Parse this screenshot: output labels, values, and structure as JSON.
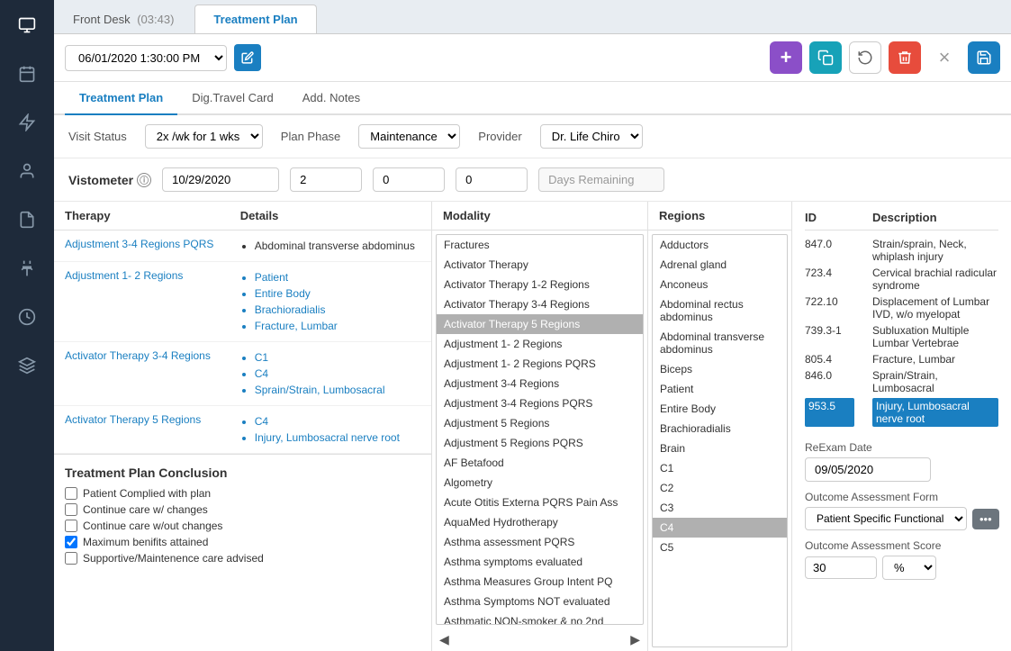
{
  "window": {
    "front_desk_label": "Front Desk",
    "timer": "(03:43)",
    "active_tab": "Treatment Plan"
  },
  "toolbar": {
    "datetime_value": "06/01/2020 1:30:00 PM",
    "edit_icon": "✎",
    "add_icon": "+",
    "copy_icon": "⧉",
    "undo_icon": "↺",
    "delete_icon": "🗑",
    "close_icon": "×",
    "save_icon": "💾"
  },
  "content_tabs": {
    "items": [
      {
        "label": "Treatment Plan",
        "active": true
      },
      {
        "label": "Dig.Travel Card",
        "active": false
      },
      {
        "label": "Add. Notes",
        "active": false
      }
    ]
  },
  "visit_status": {
    "label": "Visit Status",
    "value": "2x /wk for 1 wks",
    "plan_phase_label": "Plan Phase",
    "plan_phase_value": "Maintenance",
    "provider_label": "Provider",
    "provider_value": "Dr. Life Chiro"
  },
  "vistometer": {
    "label": "Vistometer",
    "date_value": "10/29/2020",
    "num1": "2",
    "num2": "0",
    "num3": "0",
    "days_remaining": "Days Remaining"
  },
  "therapy_table": {
    "col1": "Therapy",
    "col2": "Details",
    "rows": [
      {
        "therapy": "Adjustment 3-4 Regions PQRS",
        "details": [
          "Abdominal transverse abdominus"
        ]
      },
      {
        "therapy": "Adjustment 1- 2 Regions",
        "details": [
          "Patient",
          "Entire Body",
          "Brachioradialis",
          "Fracture, Lumbar"
        ]
      },
      {
        "therapy": "Activator Therapy 3-4 Regions",
        "details": [
          "C1",
          "C4",
          "Sprain/Strain, Lumbosacral"
        ]
      },
      {
        "therapy": "Activator Therapy 5 Regions",
        "details": [
          "C4",
          "Injury, Lumbosacral nerve root"
        ]
      }
    ]
  },
  "conclusion": {
    "title": "Treatment Plan Conclusion",
    "items": [
      {
        "label": "Patient Complied with plan",
        "checked": false
      },
      {
        "label": "Continue care w/ changes",
        "checked": false
      },
      {
        "label": "Continue care w/out changes",
        "checked": false
      },
      {
        "label": "Maximum benifits attained",
        "checked": true
      },
      {
        "label": "Supportive/Maintenence care advised",
        "checked": false
      }
    ]
  },
  "modality": {
    "header": "Modality",
    "items": [
      "Fractures",
      "Activator Therapy",
      "Activator Therapy 1-2 Regions",
      "Activator Therapy 3-4 Regions",
      "Activator Therapy 5 Regions",
      "Adjustment 1- 2 Regions",
      "Adjustment 1- 2 Regions PQRS",
      "Adjustment 3-4 Regions",
      "Adjustment 3-4 Regions PQRS",
      "Adjustment 5 Regions",
      "Adjustment 5 Regions PQRS",
      "AF Betafood",
      "Algometry",
      "Acute Otitis Externa PQRS Pain Ass",
      "AquaMed Hydrotherapy",
      "Asthma assessment PQRS",
      "Asthma symptoms evaluated",
      "Asthma Measures Group Intent PQ",
      "Asthma Symptoms NOT evaluated",
      "Asthmatic NON-smoker & no 2nd"
    ],
    "selected_index": 4
  },
  "regions": {
    "header": "Regions",
    "items": [
      "Adductors",
      "Adrenal gland",
      "Anconeus",
      "Abdominal rectus abdominus",
      "Abdominal transverse abdominus",
      "Biceps",
      "Patient",
      "Entire Body",
      "Brachioradialis",
      "Brain",
      "C1",
      "C2",
      "C3",
      "C4",
      "C5"
    ],
    "selected_index": 13
  },
  "diagnoses": {
    "id_header": "ID",
    "desc_header": "Description",
    "rows": [
      {
        "id": "847.0",
        "desc": "Strain/sprain, Neck, whiplash injury",
        "highlighted": false
      },
      {
        "id": "723.4",
        "desc": "Cervical brachial radicular syndrome",
        "highlighted": false
      },
      {
        "id": "722.10",
        "desc": "Displacement of Lumbar IVD, w/o myelopat",
        "highlighted": false
      },
      {
        "id": "739.3-1",
        "desc": "Subluxation Multiple Lumbar Vertebrae",
        "highlighted": false
      },
      {
        "id": "805.4",
        "desc": "Fracture, Lumbar",
        "highlighted": false
      },
      {
        "id": "846.0",
        "desc": "Sprain/Strain, Lumbosacral",
        "highlighted": false
      },
      {
        "id": "953.5",
        "desc": "Injury, Lumbosacral nerve root",
        "highlighted": true
      }
    ]
  },
  "reexam": {
    "label": "ReExam Date",
    "value": "09/05/2020",
    "outcome_label": "Outcome Assessment Form",
    "outcome_value": "Patient Specific Functional",
    "score_label": "Outcome Assessment Score",
    "score_value": "30",
    "score_unit": "%"
  },
  "sidebar": {
    "icons": [
      {
        "name": "monitor-icon",
        "symbol": "⬜"
      },
      {
        "name": "calendar-icon",
        "symbol": "📅"
      },
      {
        "name": "lightning-icon",
        "symbol": "⚡"
      },
      {
        "name": "user-icon",
        "symbol": "👤"
      },
      {
        "name": "file-icon",
        "symbol": "📄"
      },
      {
        "name": "plug-icon",
        "symbol": "🔌"
      },
      {
        "name": "history-icon",
        "symbol": "🕐"
      },
      {
        "name": "layers-icon",
        "symbol": "⬛"
      }
    ]
  }
}
